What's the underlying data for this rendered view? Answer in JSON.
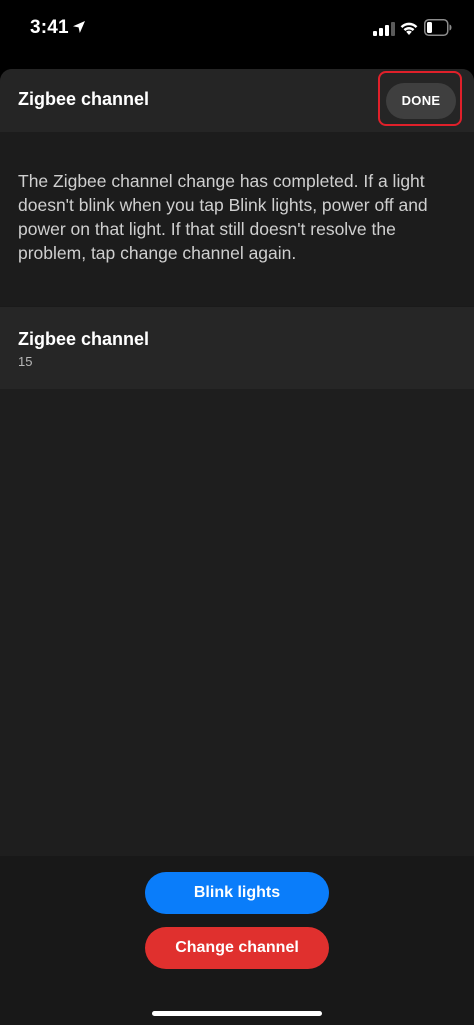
{
  "status_bar": {
    "time": "3:41",
    "location_icon": "location-arrow-icon",
    "signal_icon": "cellular-signal-icon",
    "wifi_icon": "wifi-icon",
    "battery_icon": "battery-icon"
  },
  "header": {
    "title": "Zigbee channel",
    "done_label": "DONE"
  },
  "message": "The Zigbee channel change has completed. If a light doesn't blink when you tap Blink lights, power off and power on that light. If that still doesn't resolve the problem, tap change channel again.",
  "channel": {
    "label": "Zigbee channel",
    "value": "15"
  },
  "buttons": {
    "blink_label": "Blink lights",
    "change_label": "Change channel"
  },
  "colors": {
    "blink": "#0a7dfa",
    "change": "#e0302e",
    "highlight": "#e0202a"
  }
}
